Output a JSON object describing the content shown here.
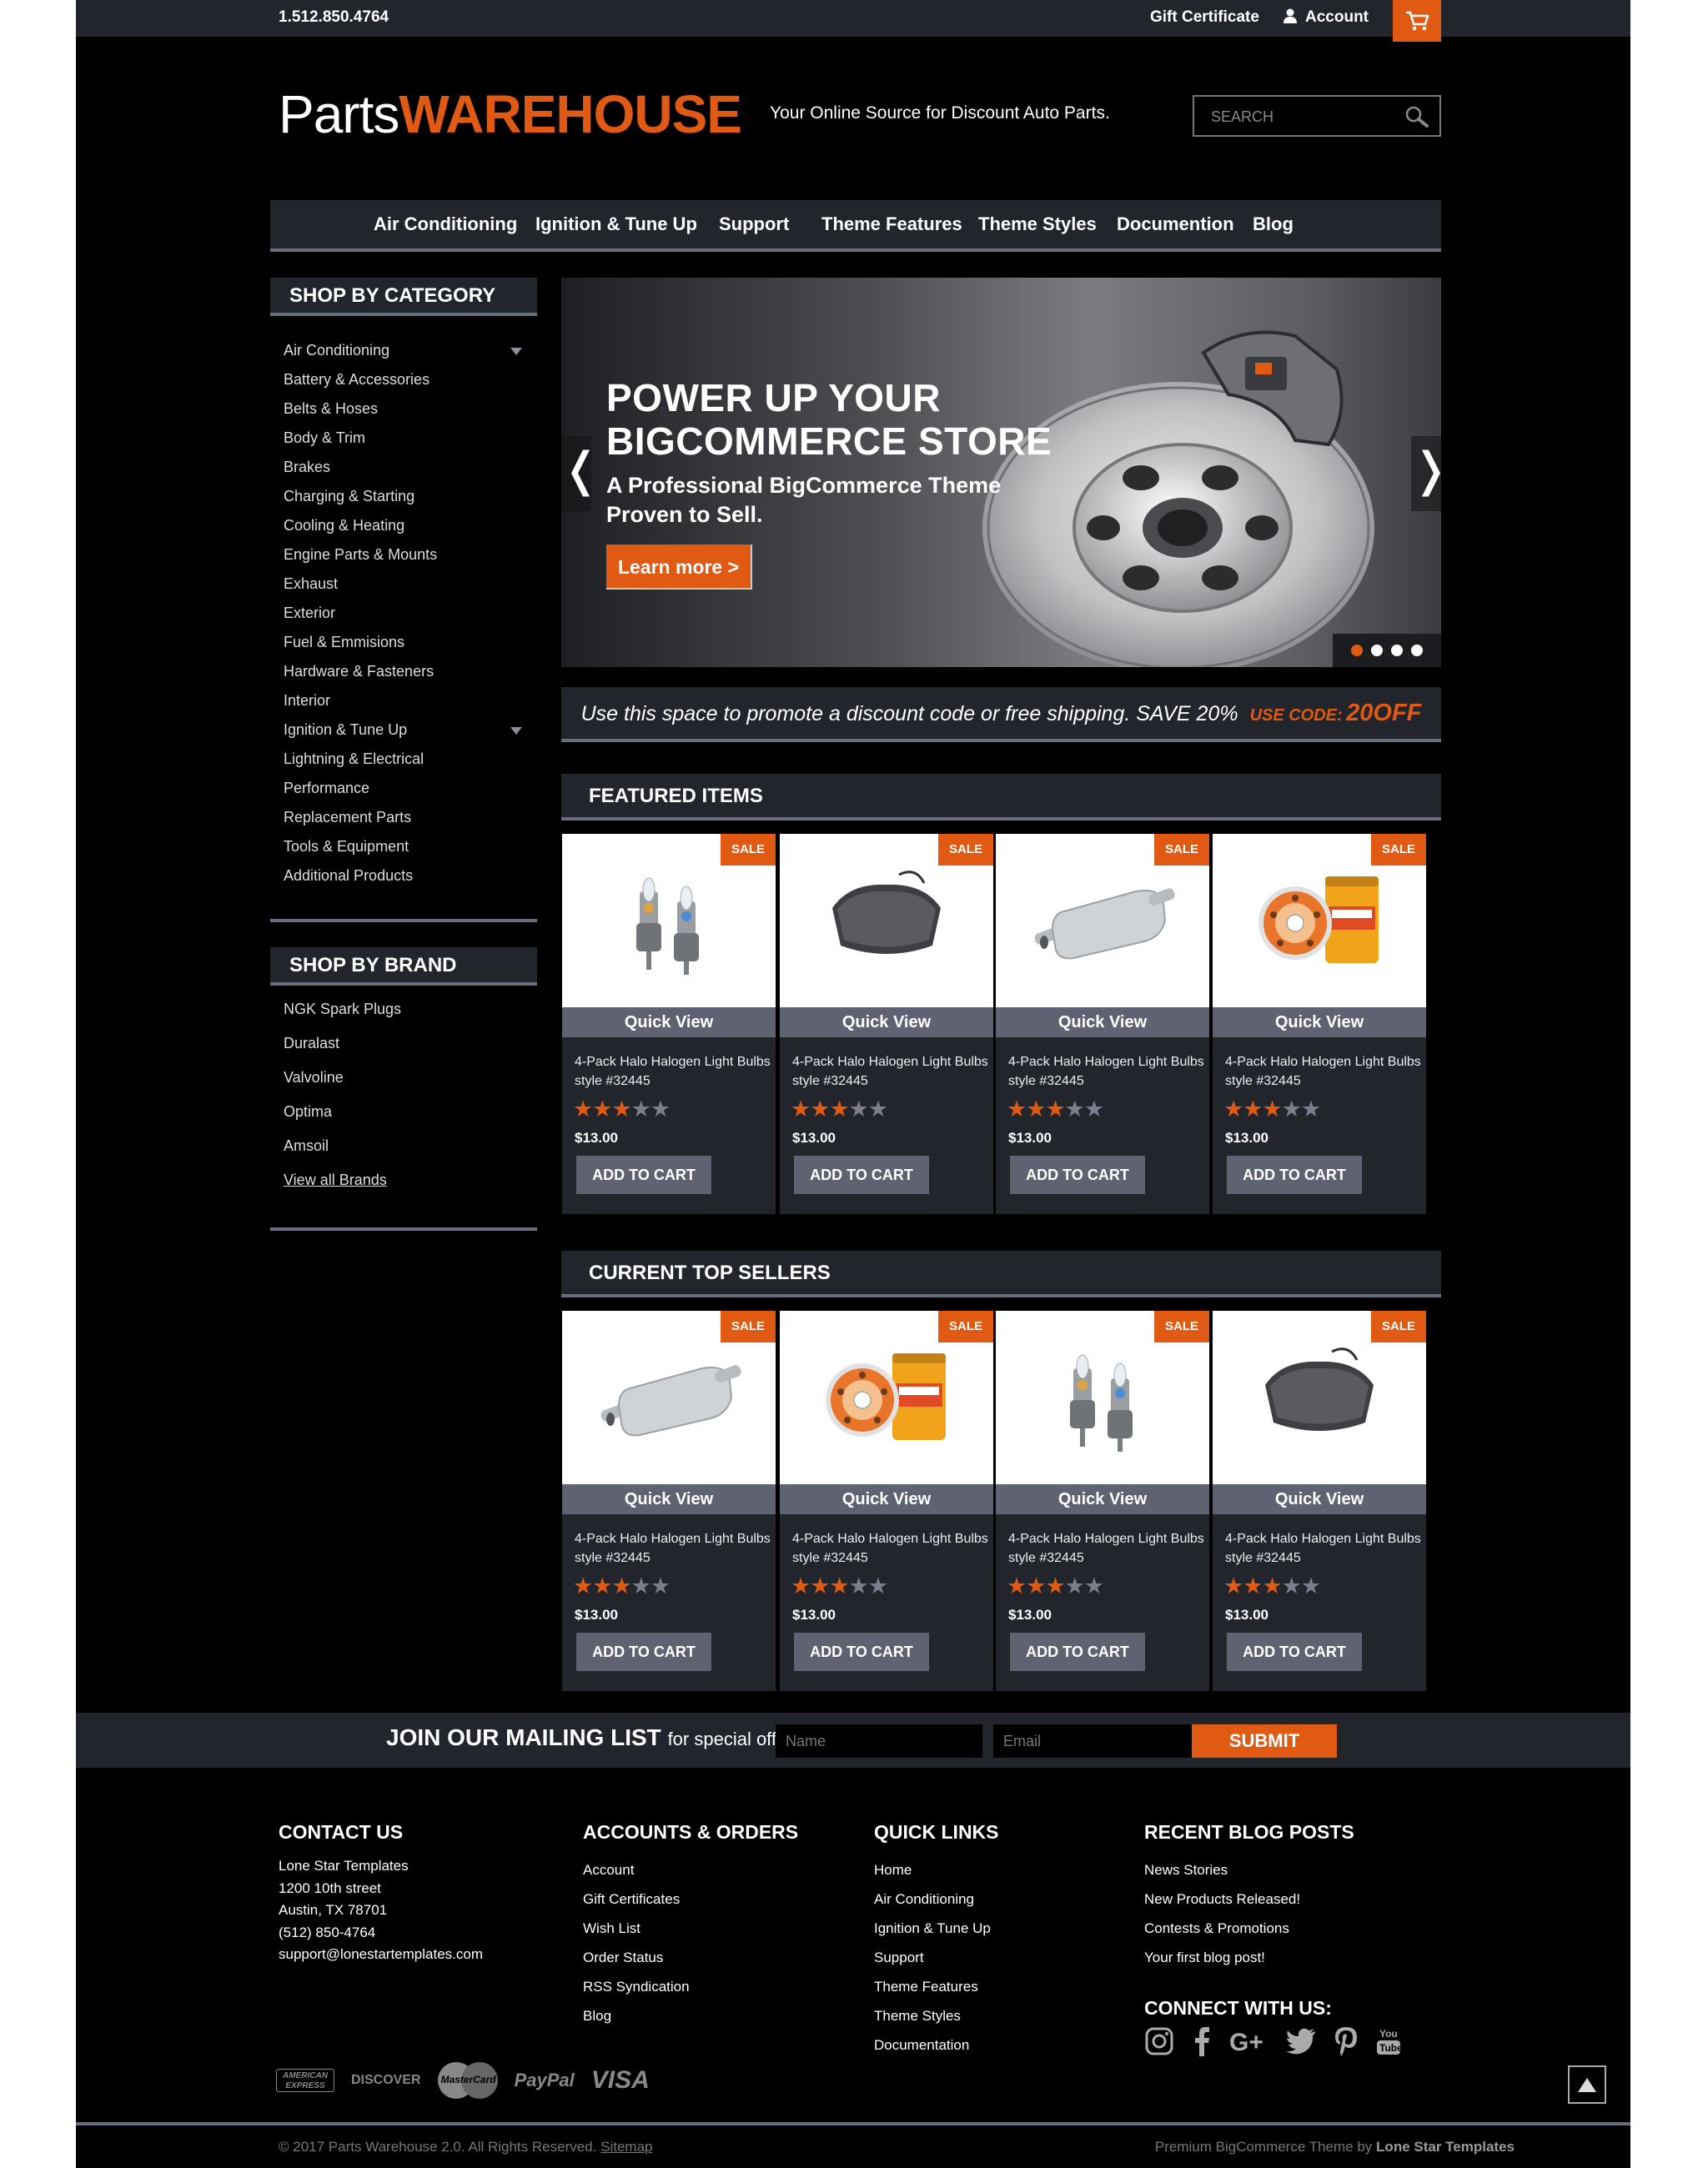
{
  "topbar": {
    "phone": "1.512.850.4764",
    "gift_certificate": "Gift Certificate",
    "account": "Account"
  },
  "header": {
    "logo_part1": "Parts",
    "logo_part2": "WAREHOUSE",
    "tagline": "Your Online Source for Discount Auto Parts.",
    "search_placeholder": "SEARCH"
  },
  "nav": {
    "items": [
      "Air Conditioning",
      "Ignition & Tune Up",
      "Support",
      "Theme Features",
      "Theme Styles",
      "Documention",
      "Blog"
    ]
  },
  "sidebar": {
    "category_title": "SHOP BY CATEGORY",
    "categories": [
      "Air Conditioning",
      "Battery & Accessories",
      "Belts & Hoses",
      "Body & Trim",
      "Brakes",
      "Charging & Starting",
      "Cooling & Heating",
      "Engine Parts & Mounts",
      "Exhaust",
      "Exterior",
      "Fuel & Emmisions",
      "Hardware & Fasteners",
      "Interior",
      "Ignition & Tune Up",
      "Lightning & Electrical",
      "Performance",
      "Replacement Parts",
      "Tools & Equipment",
      "Additional Products"
    ],
    "brand_title": "SHOP BY BRAND",
    "brands": [
      "NGK Spark Plugs",
      "Duralast",
      "Valvoline",
      "Optima",
      "Amsoil",
      "View all Brands"
    ]
  },
  "hero": {
    "title_line1": "POWER UP YOUR",
    "title_line2": "BIGCOMMERCE STORE",
    "subtitle_line1": "A Professional BigCommerce Theme",
    "subtitle_line2": "Proven to Sell.",
    "cta": "Learn more >",
    "prev": "❬",
    "next": "❭",
    "active_slide": 1,
    "slide_count": 4
  },
  "promo": {
    "text": "Use this space to promote a discount code or free shipping. SAVE 20%",
    "code_label": "USE CODE:",
    "code": "20OFF"
  },
  "featured": {
    "title": "FEATURED ITEMS",
    "products": [
      {
        "image": "halogen-bulbs",
        "sale": "SALE",
        "quick_view": "Quick View",
        "name": "4-Pack Halo Halogen Light Bulbs style #32445",
        "rating": 3,
        "price": "$13.00",
        "button": "ADD TO CART"
      },
      {
        "image": "brake-pad",
        "sale": "SALE",
        "quick_view": "Quick View",
        "name": "4-Pack Halo Halogen Light Bulbs style #32445",
        "rating": 3,
        "price": "$13.00",
        "button": "ADD TO CART"
      },
      {
        "image": "muffler",
        "sale": "SALE",
        "quick_view": "Quick View",
        "name": "4-Pack Halo Halogen Light Bulbs style #32445",
        "rating": 3,
        "price": "$13.00",
        "button": "ADD TO CART"
      },
      {
        "image": "oil-filter",
        "sale": "SALE",
        "quick_view": "Quick View",
        "name": "4-Pack Halo Halogen Light Bulbs style #32445",
        "rating": 3,
        "price": "$13.00",
        "button": "ADD TO CART"
      }
    ]
  },
  "top_sellers": {
    "title": "CURRENT TOP SELLERS",
    "products": [
      {
        "image": "muffler",
        "sale": "SALE",
        "quick_view": "Quick View",
        "name": "4-Pack Halo Halogen Light Bulbs style #32445",
        "rating": 3,
        "price": "$13.00",
        "button": "ADD TO CART"
      },
      {
        "image": "oil-filter",
        "sale": "SALE",
        "quick_view": "Quick View",
        "name": "4-Pack Halo Halogen Light Bulbs style #32445",
        "rating": 3,
        "price": "$13.00",
        "button": "ADD TO CART"
      },
      {
        "image": "halogen-bulbs",
        "sale": "SALE",
        "quick_view": "Quick View",
        "name": "4-Pack Halo Halogen Light Bulbs style #32445",
        "rating": 3,
        "price": "$13.00",
        "button": "ADD TO CART"
      },
      {
        "image": "brake-pad",
        "sale": "SALE",
        "quick_view": "Quick View",
        "name": "4-Pack Halo Halogen Light Bulbs style #32445",
        "rating": 3,
        "price": "$13.00",
        "button": "ADD TO CART"
      }
    ]
  },
  "mailing": {
    "title": "JOIN OUR MAILING LIST",
    "subtitle": "for special offers!",
    "name_placeholder": "Name",
    "email_placeholder": "Email",
    "submit": "SUBMIT"
  },
  "footer": {
    "contact_title": "CONTACT US",
    "contact_lines": [
      "Lone Star Templates",
      "1200 10th street",
      "Austin, TX 78701",
      "(512) 850-4764",
      "support@lonestartemplates.com"
    ],
    "accounts_title": "ACCOUNTS & ORDERS",
    "accounts_links": [
      "Account",
      "Gift Certificates",
      "Wish List",
      "Order Status",
      "RSS Syndication",
      "Blog"
    ],
    "quick_title": "QUICK LINKS",
    "quick_links": [
      "Home",
      "Air Conditioning",
      "Ignition & Tune Up",
      "Support",
      "Theme Features",
      "Theme Styles",
      "Documentation"
    ],
    "blog_title": "RECENT BLOG POSTS",
    "blog_links": [
      "News Stories",
      "New Products Released!",
      "Contests & Promotions",
      "Your first blog post!"
    ],
    "connect_title": "CONNECT WITH US:",
    "social_icons": [
      "instagram-icon",
      "facebook-icon",
      "google-plus-icon",
      "twitter-icon",
      "pinterest-icon",
      "youtube-icon"
    ],
    "payment": {
      "amex_line1": "AMERICAN",
      "amex_line2": "EXPRESS",
      "discover": "DISCOVER",
      "mastercard": "MasterCard",
      "paypal": "PayPal",
      "visa": "VISA"
    },
    "copyright": "© 2017 Parts Warehouse 2.0. All Rights Reserved.",
    "sitemap": "Sitemap",
    "credit_prefix": "Premium BigCommerce Theme by",
    "credit_name": "Lone Star Templates"
  },
  "colors": {
    "accent": "#e05a14",
    "bar": "#23252c",
    "divider": "#6a6d7c",
    "button": "#5f6271"
  }
}
